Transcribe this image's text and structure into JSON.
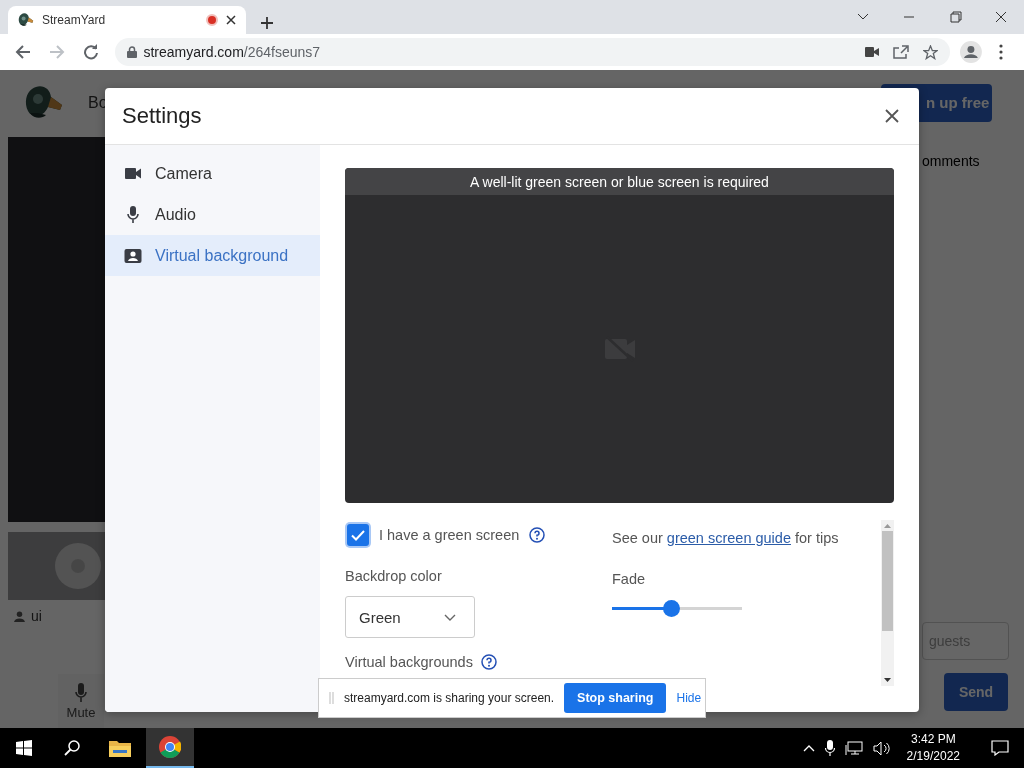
{
  "browser": {
    "tab": {
      "title": "StreamYard",
      "recording": true
    },
    "url_host": "streamyard.com",
    "url_path": "/264fseuns7"
  },
  "app": {
    "header_text": "Bo",
    "signup_button": "n up free",
    "comments_tab": "omments",
    "participant_name": "ui",
    "mute_button": "Mute",
    "message_placeholder": "guests",
    "send_button": "Send"
  },
  "settings": {
    "title": "Settings",
    "nav": [
      {
        "label": "Camera",
        "selected": false
      },
      {
        "label": "Audio",
        "selected": false
      },
      {
        "label": "Virtual background",
        "selected": true
      }
    ],
    "preview_banner": "A well-lit green screen or blue screen is required",
    "green_screen": {
      "label": "I have a green screen",
      "checked": true
    },
    "guide": {
      "before": "See our",
      "link": "green screen guide",
      "after": "for tips"
    },
    "backdrop": {
      "label": "Backdrop color",
      "value": "Green"
    },
    "fade": {
      "label": "Fade",
      "level": 0.45
    },
    "virtual_backgrounds_label": "Virtual backgrounds"
  },
  "share_bar": {
    "message": "streamyard.com is sharing your screen.",
    "stop_button": "Stop sharing",
    "hide_link": "Hide"
  },
  "taskbar": {
    "time": "3:42 PM",
    "date": "2/19/2022"
  }
}
